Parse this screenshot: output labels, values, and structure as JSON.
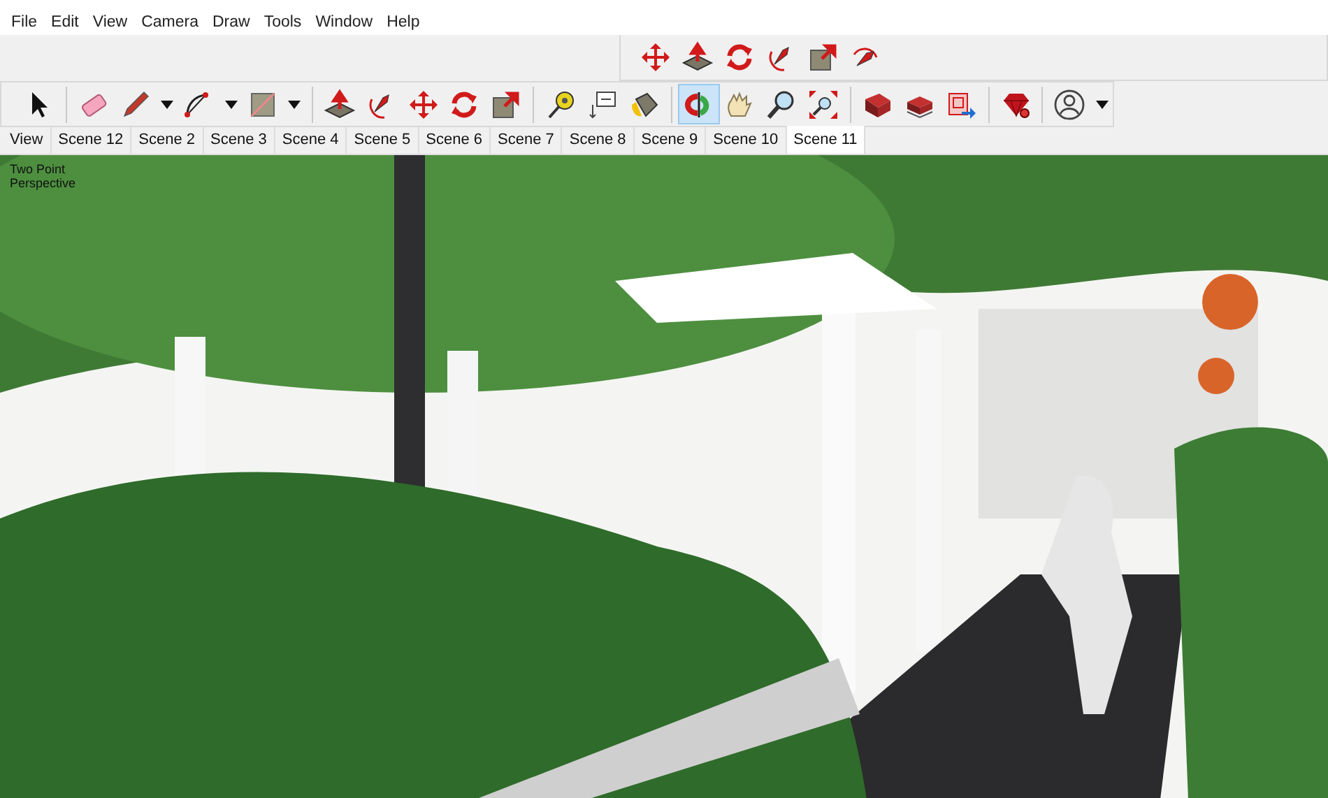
{
  "menu_bar": [
    "File",
    "Edit",
    "View",
    "Camera",
    "Draw",
    "Tools",
    "Window",
    "Help"
  ],
  "floating_toolbar": {
    "items": [
      {
        "kind": "tool",
        "selected": false
      },
      {
        "kind": "tool",
        "selected": false
      },
      {
        "kind": "tool",
        "selected": false
      },
      {
        "kind": "tool",
        "selected": false
      },
      {
        "kind": "tool",
        "selected": false
      },
      {
        "kind": "tool",
        "selected": false
      }
    ]
  },
  "main_toolbar": {
    "items": [
      {
        "kind": "tool",
        "selected": false
      },
      {
        "kind": "separator"
      },
      {
        "kind": "tool",
        "selected": false
      },
      {
        "kind": "tool",
        "selected": false
      },
      {
        "kind": "caret"
      },
      {
        "kind": "tool",
        "selected": false
      },
      {
        "kind": "caret"
      },
      {
        "kind": "tool",
        "selected": false
      },
      {
        "kind": "caret"
      },
      {
        "kind": "separator"
      },
      {
        "kind": "tool",
        "selected": false
      },
      {
        "kind": "tool",
        "selected": false
      },
      {
        "kind": "tool",
        "selected": false
      },
      {
        "kind": "tool",
        "selected": false
      },
      {
        "kind": "tool",
        "selected": false
      },
      {
        "kind": "separator"
      },
      {
        "kind": "tool",
        "selected": false
      },
      {
        "kind": "tool",
        "selected": false
      },
      {
        "kind": "tool",
        "selected": false
      },
      {
        "kind": "separator"
      },
      {
        "kind": "tool",
        "selected": true
      },
      {
        "kind": "tool",
        "selected": false
      },
      {
        "kind": "tool",
        "selected": false
      },
      {
        "kind": "tool",
        "selected": false
      },
      {
        "kind": "separator"
      },
      {
        "kind": "tool",
        "selected": false
      },
      {
        "kind": "tool",
        "selected": false
      },
      {
        "kind": "tool",
        "selected": false
      },
      {
        "kind": "separator"
      },
      {
        "kind": "tool",
        "selected": false
      },
      {
        "kind": "separator"
      },
      {
        "kind": "tool",
        "selected": false
      },
      {
        "kind": "caret"
      }
    ]
  },
  "scene_tabs": [
    {
      "label": "View",
      "selected": false
    },
    {
      "label": "Scene 12",
      "selected": false
    },
    {
      "label": "Scene 2",
      "selected": false
    },
    {
      "label": "Scene 3",
      "selected": false
    },
    {
      "label": "Scene 4",
      "selected": false
    },
    {
      "label": "Scene 5",
      "selected": false
    },
    {
      "label": "Scene 6",
      "selected": false
    },
    {
      "label": "Scene 7",
      "selected": false
    },
    {
      "label": "Scene 8",
      "selected": false
    },
    {
      "label": "Scene 9",
      "selected": false
    },
    {
      "label": "Scene 10",
      "selected": false
    },
    {
      "label": "Scene 11",
      "selected": true
    }
  ],
  "viewport": {
    "camera_label": "Two Point Perspective",
    "kind": "picture"
  }
}
